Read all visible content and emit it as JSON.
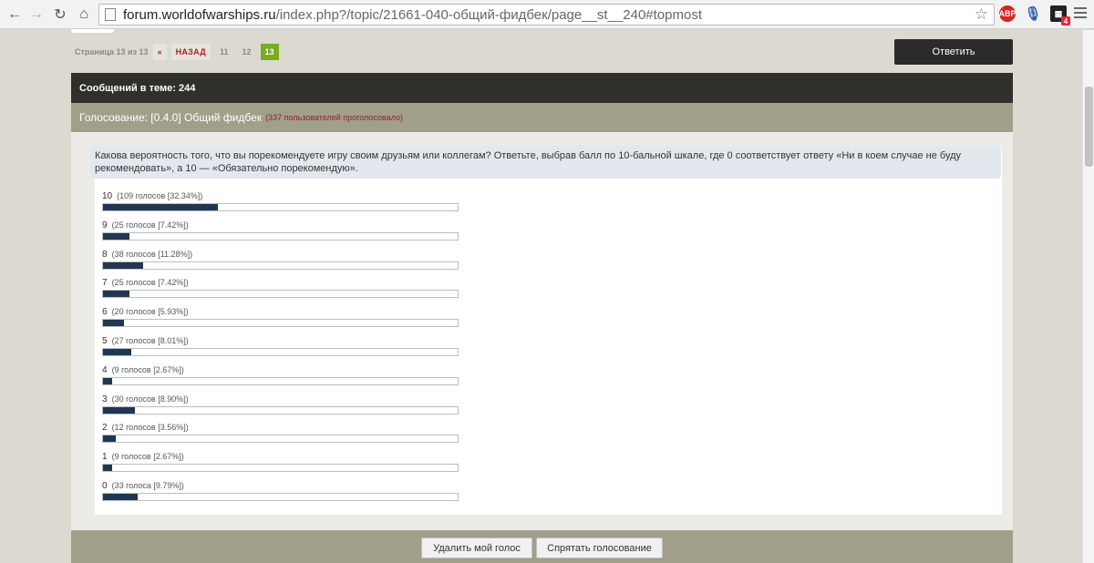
{
  "browser": {
    "url_host": "forum.worldofwarships.ru",
    "url_path": "/index.php?/topic/21661-040-общий-фидбек/page__st__240#topmost",
    "icons": [
      "back-arrow-icon",
      "forward-arrow-icon",
      "reload-icon",
      "home-icon",
      "page-icon",
      "star-icon",
      "adblock-icon",
      "microphone-icon",
      "extension-icon",
      "menu-icon"
    ],
    "abp_label": "ABP",
    "ext_badge": "4"
  },
  "pagination": {
    "page_count": "Страница 13 из 13",
    "first": "«",
    "prev": "НАЗАД",
    "pages": [
      "11",
      "12"
    ],
    "current": "13"
  },
  "reply_button": "Ответить",
  "topic": {
    "post_count": "Сообщений в теме: 244"
  },
  "poll": {
    "title": "Голосование: [0.4.0] Общий фидбек",
    "voters": "(337 пользователей проголосовало)",
    "question": "Какова вероятность того, что вы порекомендуете игру своим друзьям или коллегам? Ответьте, выбрав балл по 10-бальной шкале, где 0 соответствует ответу «Ни в коем случае не буду рекомендовать», а 10 — «Обязательно порекомендую».",
    "choices": [
      {
        "label": "10",
        "votes": "(109 голосов [32.34%])",
        "percent": 32.34
      },
      {
        "label": "9",
        "votes": "(25 голосов [7.42%])",
        "percent": 7.42
      },
      {
        "label": "8",
        "votes": "(38 голосов [11.28%])",
        "percent": 11.28
      },
      {
        "label": "7",
        "votes": "(25 голосов [7.42%])",
        "percent": 7.42
      },
      {
        "label": "6",
        "votes": "(20 голосов [5.93%])",
        "percent": 5.93
      },
      {
        "label": "5",
        "votes": "(27 голосов [8.01%])",
        "percent": 8.01
      },
      {
        "label": "4",
        "votes": "(9 голосов [2.67%])",
        "percent": 2.67
      },
      {
        "label": "3",
        "votes": "(30 голосов [8.90%])",
        "percent": 8.9
      },
      {
        "label": "2",
        "votes": "(12 голосов [3.56%])",
        "percent": 3.56
      },
      {
        "label": "1",
        "votes": "(9 голосов [2.67%])",
        "percent": 2.67
      },
      {
        "label": "0",
        "votes": "(33 голоса [9.79%])",
        "percent": 9.79
      }
    ],
    "delete_vote_button": "Удалить мой голос",
    "hide_poll_button": "Спрятать голосование"
  },
  "colors": {
    "bar_fill": "#223651",
    "topic_header_bg": "#302f2a",
    "poll_header_bg": "#a19f8a",
    "current_page": "#7aab1f",
    "voters_text": "#8a2520"
  }
}
